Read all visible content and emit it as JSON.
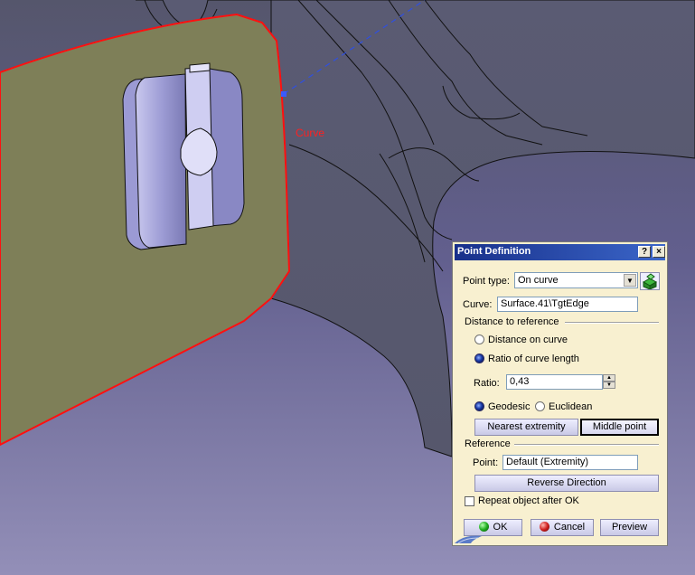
{
  "viewport": {
    "curve_label": "Curve",
    "colors": {
      "background_top": "#5d5e74",
      "background_bottom": "#8a86b0",
      "surface": "#7e7f58",
      "highlight": "#ff1010"
    }
  },
  "dialog": {
    "title": "Point Definition",
    "help_button": "?",
    "close_button": "×",
    "point_type_label": "Point type:",
    "point_type_value": "On curve",
    "curve_label": "Curve:",
    "curve_value": "Surface.41\\TgtEdge",
    "distance_group": "Distance to reference",
    "distance_on_curve": "Distance on curve",
    "ratio_of_curve_length": "Ratio of curve length",
    "ratio_label": "Ratio:",
    "ratio_value": "0,43",
    "geodesic": "Geodesic",
    "euclidean": "Euclidean",
    "nearest_extremity": "Nearest extremity",
    "middle_point": "Middle point",
    "reference_group": "Reference",
    "point_label": "Point:",
    "point_value": "Default (Extremity)",
    "reverse_direction": "Reverse Direction",
    "repeat_object": "Repeat object after OK",
    "ok": "OK",
    "cancel": "Cancel",
    "preview": "Preview",
    "selected_option": "ratio_of_curve_length",
    "selected_mode": "geodesic",
    "repeat_checked": false
  }
}
